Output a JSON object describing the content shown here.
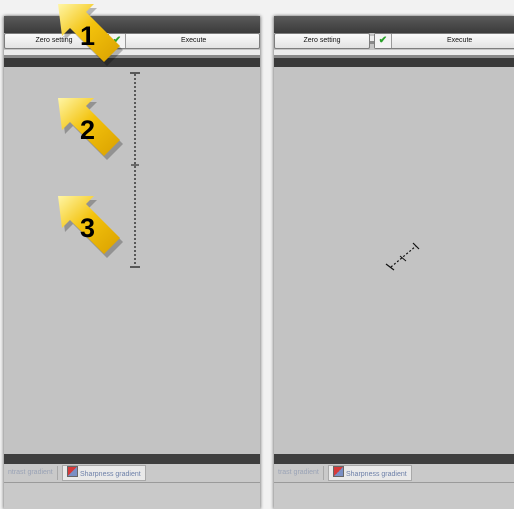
{
  "left_panel": {
    "tabs": [
      "ntrast gradient",
      "Sharpness gradient"
    ],
    "buttons": {
      "zero": "Zero setting",
      "execute": "Execute"
    }
  },
  "right_panel": {
    "tabs": [
      "trast gradient",
      "Sharpness gradient"
    ],
    "buttons": {
      "zero": "Zero setting",
      "execute": "Execute"
    }
  },
  "callouts": [
    "1",
    "2",
    "3"
  ],
  "colors": {
    "callout_yellow": "#f3c20c",
    "canvas": "#c3c3c3",
    "execute_check": "#2aa12a"
  }
}
